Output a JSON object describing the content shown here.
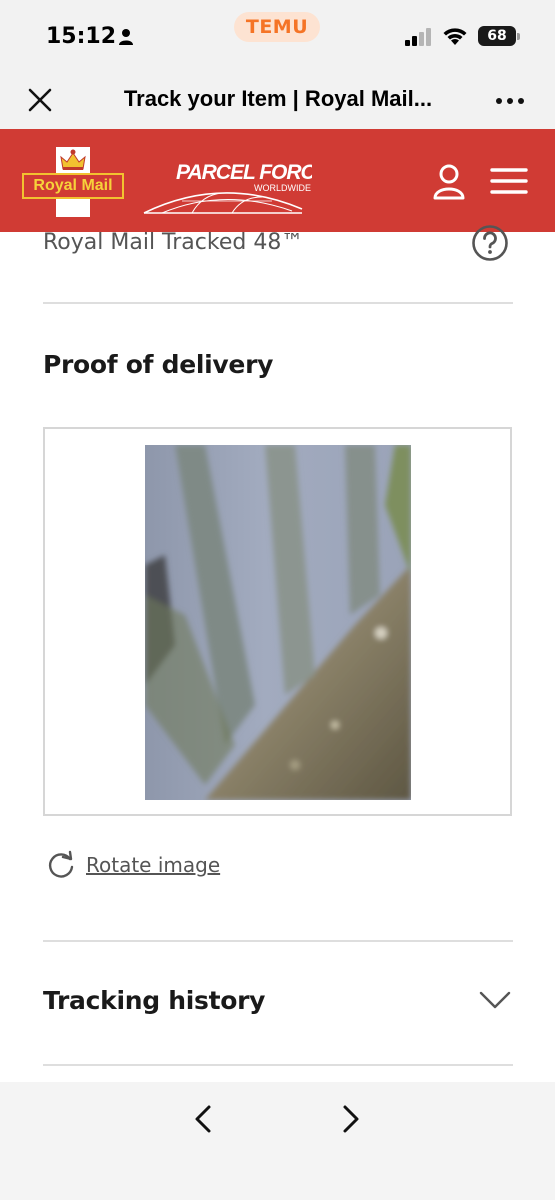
{
  "status_bar": {
    "time": "15:12",
    "app_pill": "TEMU",
    "battery": "68",
    "icons": [
      "person-icon",
      "signal-icon",
      "wifi-icon",
      "battery-icon"
    ]
  },
  "browser": {
    "title": "Track your Item | Royal Mail...",
    "icons": [
      "close-icon",
      "more-icon"
    ]
  },
  "header": {
    "royal_mail_logo_text": "Royal Mail",
    "parcelforce_logo_text": "PARCEL FORCE",
    "parcelforce_sub_text": "WORLDWIDE",
    "icons": [
      "user-icon",
      "menu-icon"
    ],
    "colors": {
      "brand_red": "#d03b34",
      "logo_yellow": "#f6d23a"
    }
  },
  "content": {
    "service_name": "Royal Mail Tracked 48™",
    "proof_heading": "Proof of delivery",
    "rotate_label": "Rotate image",
    "tracking_history_label": "Tracking history",
    "icons": [
      "help-icon",
      "rotate-icon",
      "chevron-down-icon"
    ]
  },
  "bottom_nav": {
    "icons": [
      "chevron-left-icon",
      "chevron-right-icon"
    ]
  }
}
